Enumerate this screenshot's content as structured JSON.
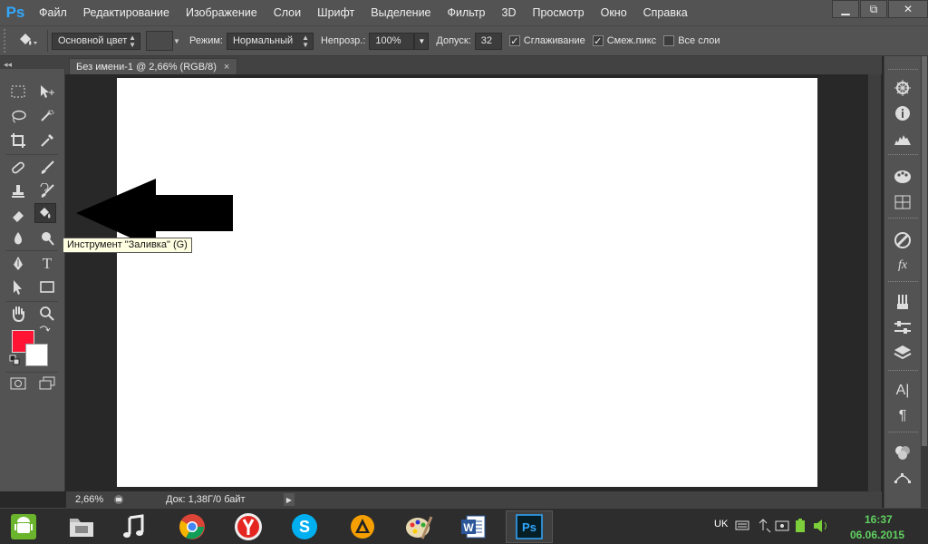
{
  "app": {
    "logo": "Ps"
  },
  "menu": [
    "Файл",
    "Редактирование",
    "Изображение",
    "Слои",
    "Шрифт",
    "Выделение",
    "Фильтр",
    "3D",
    "Просмотр",
    "Окно",
    "Справка"
  ],
  "window_controls": {
    "minimize": "▁",
    "restore": "⧉",
    "close": "✕"
  },
  "options": {
    "fill_source": "Основной цвет",
    "mode_label": "Режим:",
    "mode_value": "Нормальный",
    "opacity_label": "Непрозр.:",
    "opacity_value": "100%",
    "tolerance_label": "Допуск:",
    "tolerance_value": "32",
    "antialias_label": "Сглаживание",
    "antialias_checked": true,
    "contiguous_label": "Смеж.пикс",
    "contiguous_checked": true,
    "all_layers_label": "Все слои",
    "all_layers_checked": false
  },
  "document": {
    "tab_title": "Без имени-1 @ 2,66% (RGB/8)",
    "tab_close": "×",
    "zoom": "2,66%",
    "doc_info": "Док: 1,38Г/0 байт"
  },
  "colors": {
    "foreground": "#ff1433",
    "background": "#ffffff",
    "canvas": "#ffffff"
  },
  "tooltip": "Инструмент \"Заливка\" (G)",
  "taskbar": {
    "apps": [
      "android-icon",
      "files-icon",
      "music-icon",
      "chrome-icon",
      "yandex-icon",
      "skype-icon",
      "aimp-icon",
      "paint-icon",
      "word-icon",
      "photoshop-icon"
    ],
    "word_label": "W",
    "ps_label": "Ps",
    "lang": "UK",
    "time": "16:37",
    "date": "06.06.2015"
  }
}
